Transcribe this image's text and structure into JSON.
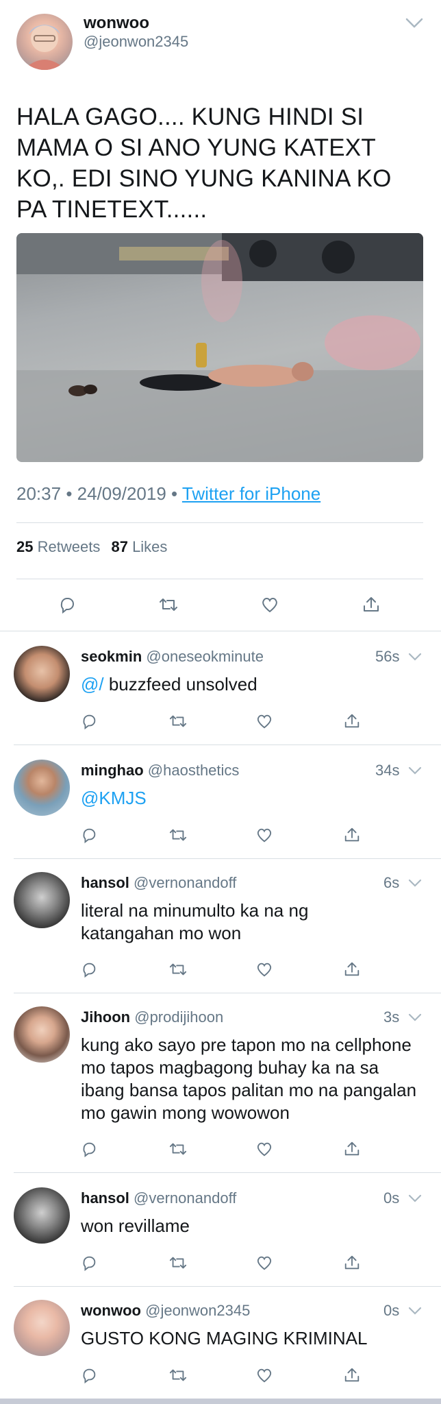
{
  "main_tweet": {
    "name": "wonwoo",
    "handle": "@jeonwon2345",
    "text": "HALA GAGO.... KUNG HINDI SI MAMA O SI ANO YUNG KATEXT KO,. EDI SINO YUNG KANINA KO PA TINETEXT......",
    "time": "20:37",
    "date": "24/09/2019",
    "source": "Twitter for iPhone",
    "retweets_count": "25",
    "retweets_label": "Retweets",
    "likes_count": "87",
    "likes_label": "Likes",
    "separator": "•"
  },
  "replies": [
    {
      "name": "seokmin",
      "handle": "@oneseokminute",
      "time": "56s",
      "mention": "@/",
      "text": " buzzfeed unsolved"
    },
    {
      "name": "minghao",
      "handle": "@haosthetics",
      "time": "34s",
      "mention": "@KMJS",
      "text": ""
    },
    {
      "name": "hansol",
      "handle": "@vernonandoff",
      "time": "6s",
      "text": "literal na minumulto ka na ng katangahan mo won"
    },
    {
      "name": "Jihoon",
      "handle": "@prodijihoon",
      "time": "3s",
      "text": "kung ako sayo pre tapon mo na cellphone mo tapos magbagong buhay ka na sa ibang bansa tapos palitan mo na pangalan mo gawin mong wowowon"
    },
    {
      "name": "hansol",
      "handle": "@vernonandoff",
      "time": "0s",
      "text": "won revillame"
    },
    {
      "name": "wonwoo",
      "handle": "@jeonwon2345",
      "time": "0s",
      "text": "GUSTO KONG MAGING KRIMINAL"
    }
  ],
  "colors": {
    "link": "#1da1f2",
    "muted": "#657786",
    "text": "#14171a",
    "divider": "#d8dee3"
  },
  "icons": [
    "reply-icon",
    "retweet-icon",
    "like-icon",
    "share-icon",
    "chevron-down-icon"
  ]
}
